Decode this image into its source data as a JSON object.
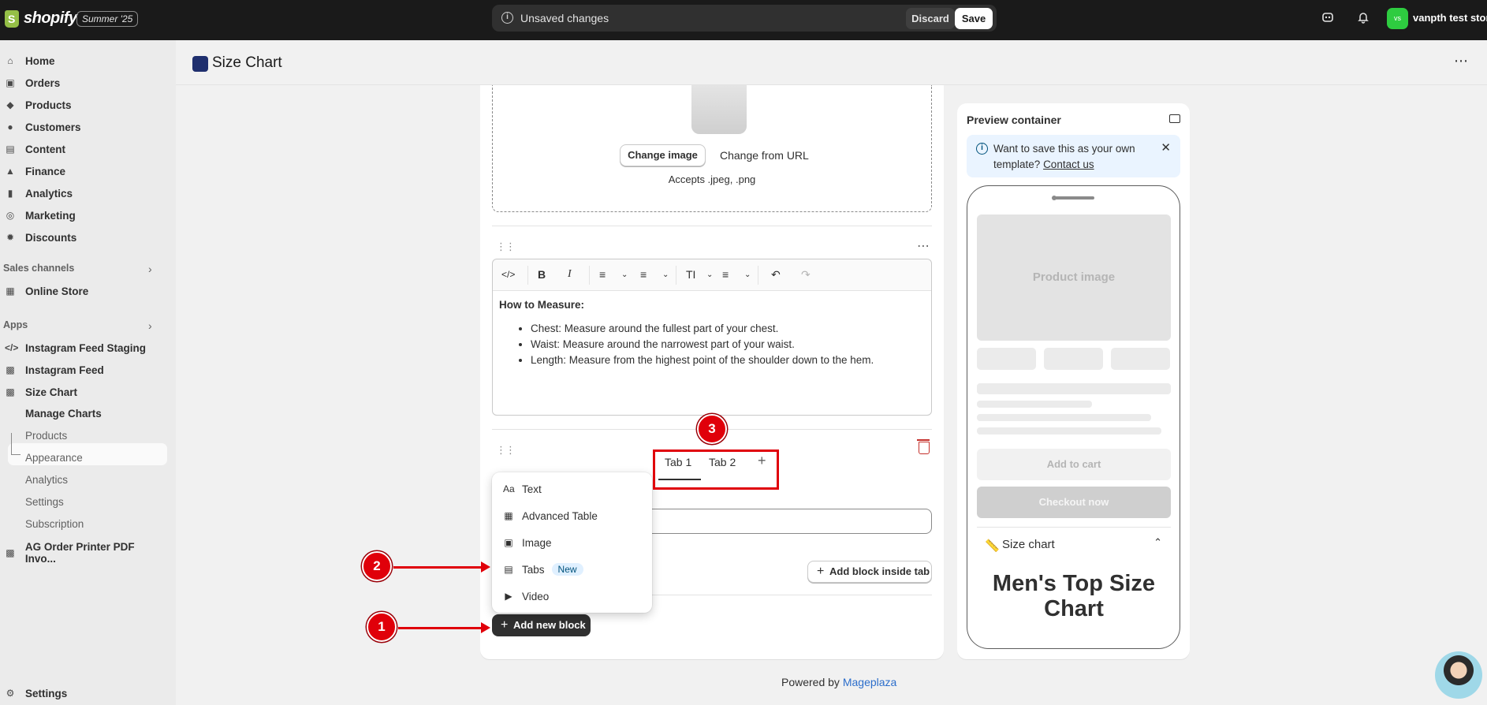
{
  "topbar": {
    "logo_text": "shopify",
    "season_badge": "Summer '25",
    "unsaved_label": "Unsaved changes",
    "discard_label": "Discard",
    "save_label": "Save",
    "avatar_initials": "vs",
    "store_name": "vanpth test store",
    "avatar_color": "#2ecc40"
  },
  "sidebar": {
    "items": [
      {
        "label": "Home",
        "icon": "home-icon"
      },
      {
        "label": "Orders",
        "icon": "orders-icon"
      },
      {
        "label": "Products",
        "icon": "tag-icon"
      },
      {
        "label": "Customers",
        "icon": "person-icon"
      },
      {
        "label": "Content",
        "icon": "content-icon"
      },
      {
        "label": "Finance",
        "icon": "bank-icon"
      },
      {
        "label": "Analytics",
        "icon": "bar-chart-icon"
      },
      {
        "label": "Marketing",
        "icon": "target-icon"
      },
      {
        "label": "Discounts",
        "icon": "discount-icon"
      }
    ],
    "sales_channels_label": "Sales channels",
    "online_store_label": "Online Store",
    "apps_label": "Apps",
    "apps": [
      {
        "label": "Instagram Feed Staging"
      },
      {
        "label": "Instagram Feed"
      },
      {
        "label": "Size Chart"
      }
    ],
    "size_chart_sub": [
      "Manage Charts",
      "Products",
      "Appearance",
      "Analytics",
      "Settings",
      "Subscription"
    ],
    "ag_app_label": "AG Order Printer PDF Invo...",
    "settings_label": "Settings"
  },
  "page": {
    "title": "Size Chart",
    "more_label": "⋯"
  },
  "editor": {
    "change_image_label": "Change image",
    "change_url_label": "Change from URL",
    "accepts_label": "Accepts .jpeg, .png",
    "text_block": {
      "heading": "How to Measure:",
      "bullets": [
        "Chest: Measure around the fullest part of your chest.",
        "Waist: Measure around the narrowest part of your waist.",
        "Length: Measure from the highest point of the shoulder down to the hem."
      ]
    },
    "tabs": [
      "Tab 1",
      "Tab 2"
    ],
    "add_tab_label": "+",
    "add_block_inside_tab_label": "Add block inside tab",
    "add_new_block_label": "Add new block"
  },
  "block_menu": {
    "items": [
      {
        "label": "Text",
        "icon": "text-icon"
      },
      {
        "label": "Advanced Table",
        "icon": "table-icon"
      },
      {
        "label": "Image",
        "icon": "image-icon"
      },
      {
        "label": "Tabs",
        "icon": "tabs-icon",
        "badge": "New"
      },
      {
        "label": "Video",
        "icon": "play-icon"
      }
    ]
  },
  "annotations": {
    "step1": "1",
    "step2": "2",
    "step3": "3",
    "color": "#e0000a"
  },
  "preview": {
    "title": "Preview container",
    "banner_text": "Want to save this as your own template?",
    "banner_link": "Contact us",
    "product_image_label": "Product image",
    "add_to_cart_label": "Add to cart",
    "checkout_label": "Checkout now",
    "size_chart_label": "Size chart",
    "chart_title": "Men's Top Size Chart"
  },
  "footer": {
    "powered_by": "Powered by",
    "powered_link": "Mageplaza"
  }
}
